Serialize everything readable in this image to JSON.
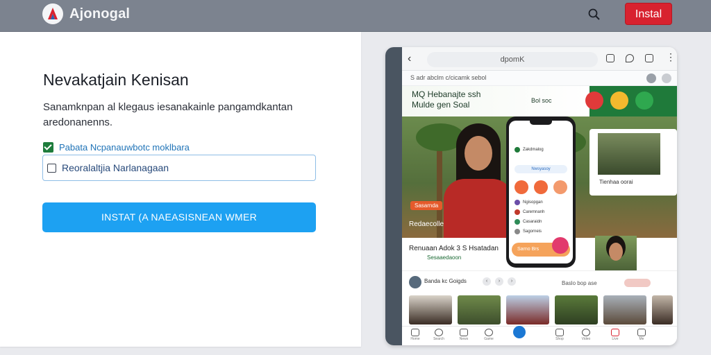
{
  "header": {
    "brand": "Ajonogal",
    "install_label": "Instal",
    "search_icon": "search-icon",
    "logo_icon": "brand-logo"
  },
  "panel": {
    "title": "Nevakatjain Kenisan",
    "description": "Sanamknpan al klegaus iesanakainle pangamdkantan aredonanenns.",
    "option1": {
      "label": "Pabata Ncpanauwbotc moklbara",
      "checked": true
    },
    "option2": {
      "label": "Reoralaltjia Narlanagaan",
      "checked": false
    },
    "cta_label": "INSTAT (A NAEASISNEAN WMER"
  },
  "preview": {
    "address": "dpomK",
    "subbar_text": "S adr abclm c/cicamk sebol",
    "hero_title_1": "MQ Hebanajte ssh",
    "hero_title_2": "Mulde gen Soal",
    "hero_pill": "Bol soc",
    "scene_tag": "Sasarnda",
    "scene_caption": "Redaecolle",
    "gallery_caption": "Tienhaa oorai",
    "phone": {
      "row1": "Zakdmalog",
      "input": "Nwsyasoy",
      "row2": "Ngisopgan",
      "row3": "Caremnanh",
      "row4": "Casaraidn",
      "row5": "Sagorneis",
      "cta": "Sarno Brs"
    },
    "info_title": "Renuaan Adok 3 S Hsatadan",
    "info_sub": "Sesaaedaoon",
    "section_title": "Banda kc Goigds",
    "section_right": "Baslo bop ase",
    "tabs": [
      "Home",
      "Search",
      "News",
      "Game",
      "Shop",
      "Video",
      "Live",
      "Me"
    ]
  },
  "colors": {
    "topbar": "#7c838f",
    "install": "#d8222f",
    "cta": "#1da1f2",
    "hero_green": "#1f7a3a"
  }
}
